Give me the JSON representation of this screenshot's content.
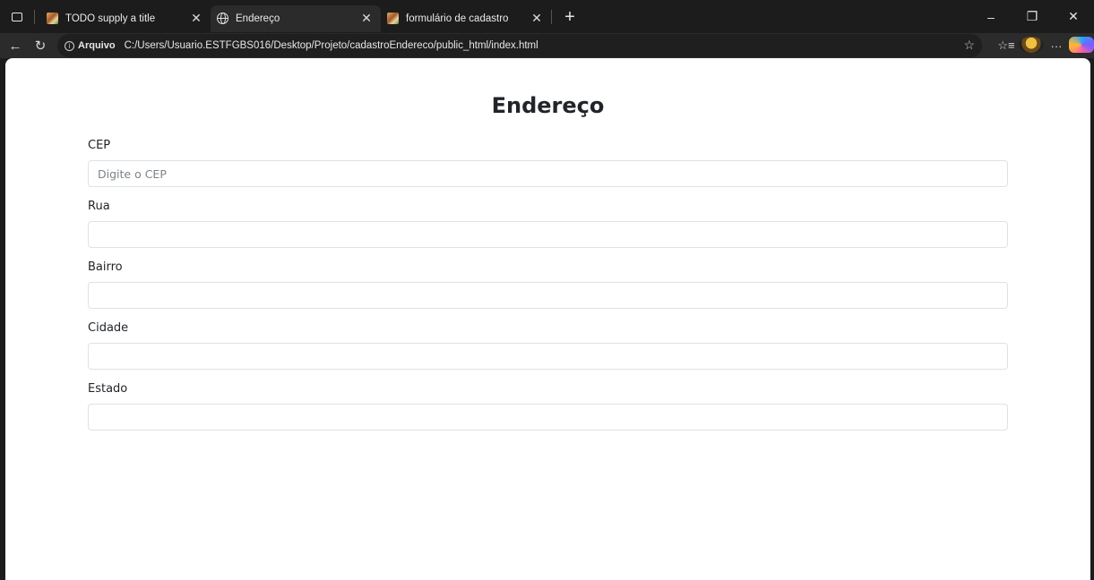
{
  "tabs": [
    {
      "title": "TODO supply a title",
      "icon": "image-favicon-icon",
      "active": false
    },
    {
      "title": "Endereço",
      "icon": "globe-icon",
      "active": true
    },
    {
      "title": "formulário de cadastro",
      "icon": "image-favicon-icon",
      "active": false
    }
  ],
  "addressbar": {
    "chip": "Arquivo",
    "url": "C:/Users/Usuario.ESTFGBS016/Desktop/Projeto/cadastroEndereco/public_html/index.html"
  },
  "page": {
    "title": "Endereço",
    "fields": [
      {
        "label": "CEP",
        "placeholder": "Digite o CEP",
        "value": ""
      },
      {
        "label": "Rua",
        "placeholder": "",
        "value": ""
      },
      {
        "label": "Bairro",
        "placeholder": "",
        "value": ""
      },
      {
        "label": "Cidade",
        "placeholder": "",
        "value": ""
      },
      {
        "label": "Estado",
        "placeholder": "",
        "value": ""
      }
    ]
  },
  "colors": {
    "chrome_bg": "#1c1c1c",
    "toolbar_bg": "#2b2b2b",
    "page_bg": "#ffffff",
    "input_border": "#dee2e6"
  }
}
